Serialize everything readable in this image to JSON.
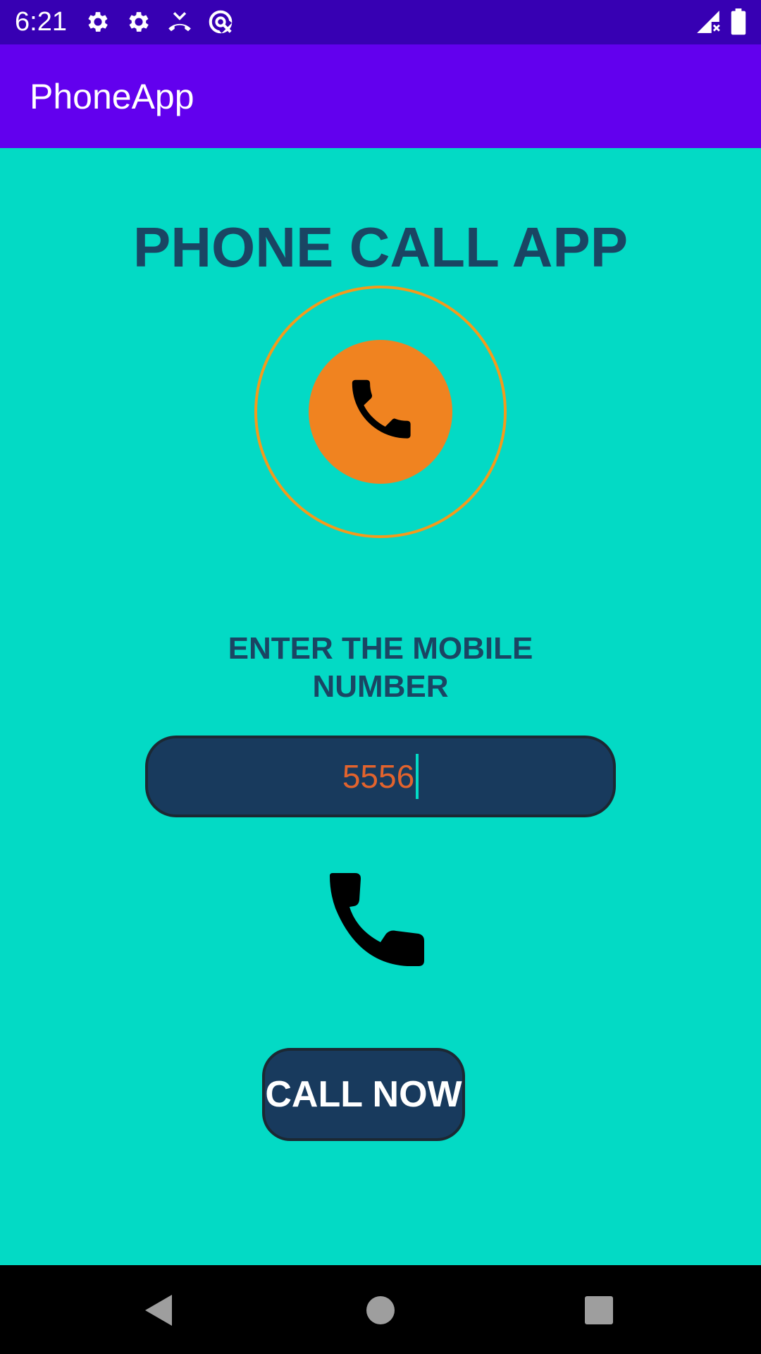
{
  "status_bar": {
    "time": "6:21",
    "icons": [
      "gear-icon",
      "gear-icon",
      "missed-call-icon",
      "data-saver-icon",
      "signal-icon",
      "battery-icon"
    ]
  },
  "app_bar": {
    "title": "PhoneApp"
  },
  "main": {
    "headline": "PHONE CALL APP",
    "hero_icon": "phone-circle-icon",
    "prompt": "ENTER THE MOBILE NUMBER",
    "number_input": {
      "value": "5556"
    },
    "call_icon": "phone-icon",
    "call_button_label": "CALL NOW"
  },
  "nav_bar": {
    "buttons": [
      "back-icon",
      "home-icon",
      "recents-icon"
    ]
  },
  "colors": {
    "status_bar": "#3700b3",
    "app_bar": "#6200ee",
    "background": "#03dac5",
    "dark_navy": "#183a5d",
    "heading_text": "#1a4563",
    "accent_orange": "#f08320",
    "input_text": "#e2632d"
  }
}
